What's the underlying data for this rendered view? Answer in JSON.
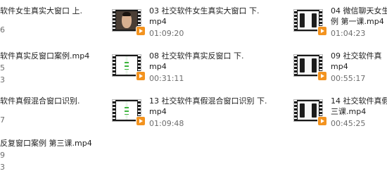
{
  "files_view": {
    "items": [
      {
        "name_line1": "软件女生真实大窗口 上.",
        "name_line2": "",
        "duration": "6",
        "thumb": "none"
      },
      {
        "name_line1": "03 社交软件女生真实大窗口 下.",
        "name_line2": "mp4",
        "duration": "01:09:20",
        "thumb": "face"
      },
      {
        "name_line1": "04 微信聊天女生",
        "name_line2": "例 第一课.mp4",
        "duration": "01:04:23",
        "thumb": "phones"
      },
      {
        "name_line1": "软件真实反窗口案例.mp4",
        "name_line2": "",
        "duration": "5",
        "duration2": "3",
        "thumb": "none"
      },
      {
        "name_line1": "08 社交软件真实反窗口 下.",
        "name_line2": "mp4",
        "duration": "00:31:11",
        "thumb": "green"
      },
      {
        "name_line1": "09 社交软件真",
        "name_line2": "mp4",
        "duration": "00:55:17",
        "thumb": "phones"
      },
      {
        "name_line1": "软件真假混合窗口识别.",
        "name_line2": "",
        "duration": "7",
        "thumb": "none"
      },
      {
        "name_line1": "13 社交软件真假混合窗口识别 下.",
        "name_line2": "mp4",
        "duration": "01:09:48",
        "thumb": "green"
      },
      {
        "name_line1": "14 社交软件真假",
        "name_line2": "三课.mp4",
        "duration": "00:45:25",
        "thumb": "phones"
      },
      {
        "name_line1": "反复窗口案例 第三课.mp4",
        "name_line2": "",
        "duration": "9",
        "duration2": "3",
        "thumb": "none"
      }
    ]
  }
}
